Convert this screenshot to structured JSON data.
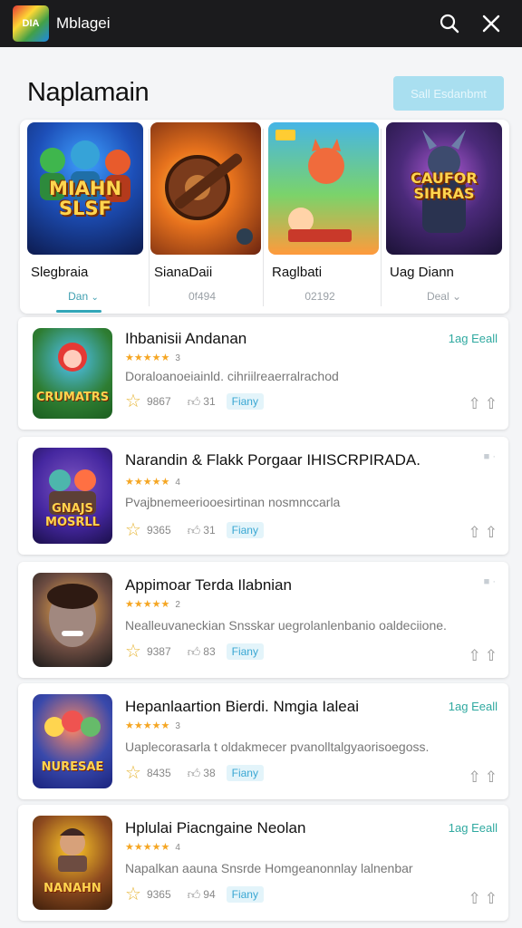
{
  "header": {
    "logo_text": "DIA",
    "app_name": "Mblagei"
  },
  "main": {
    "title": "Naplamain",
    "cta_label": "Sall Esdanbmt"
  },
  "featured": [
    {
      "art_text": "MIAHN SLSF",
      "name": "Slegbraia",
      "meta": "Dan",
      "meta_is_link": true
    },
    {
      "art_text": "",
      "name": "SianaDaii",
      "meta": "0f494",
      "meta_is_link": false
    },
    {
      "art_text": "",
      "name": "Raglbati",
      "meta": "02192",
      "meta_is_link": false
    },
    {
      "art_text": "CAUFOR SIHRAS",
      "name": "Uag Diann",
      "meta": "Deal",
      "meta_is_link": false
    }
  ],
  "list": [
    {
      "icon_text": "CRUMATRS",
      "title": "Ihbanisii Andanan",
      "rating_count": "3",
      "desc": "Doraloanoeiainld. cihriilreaerralrachod",
      "views": "9867",
      "likes": "31",
      "pill": "Fiany",
      "tag": "1ag Eeall"
    },
    {
      "icon_text": "GNAJS MOSRLL",
      "title": "Narandin & Flakk Porgaar IHISCRPIRADA.",
      "rating_count": "4",
      "desc": "Pvajbnemeeriooesirtinan nosmnccarla",
      "views": "9365",
      "likes": "31",
      "pill": "Fiany",
      "tag": ""
    },
    {
      "icon_text": "",
      "title": "Appimoar Terda Ilabnian",
      "rating_count": "2",
      "desc": "Nealleuvaneckian Snsskar uegrolanlenbanio oaldeciione.",
      "views": "9387",
      "likes": "83",
      "pill": "Fiany",
      "tag": ""
    },
    {
      "icon_text": "NURESAE",
      "title": "Hepanlaartion Bierdi. Nmgia Ialeai",
      "rating_count": "3",
      "desc": "Uaplecorasarla t oldakmecer pvanolltalgyaorisoegoss.",
      "views": "8435",
      "likes": "38",
      "pill": "Fiany",
      "tag": "1ag Eeall"
    },
    {
      "icon_text": "NANAHN",
      "title": "Hplulai Piacngaine Neolan",
      "rating_count": "4",
      "desc": "Napalkan aauna  Snsrde Homgeanonnlay lalnenbar",
      "views": "9365",
      "likes": "94",
      "pill": "Fiany",
      "tag": "1ag Eeall"
    }
  ],
  "colors": {
    "accent": "#33a6b8",
    "tag": "#2fa9a0",
    "star": "#f5a623",
    "cta_bg": "#a9dff0"
  }
}
